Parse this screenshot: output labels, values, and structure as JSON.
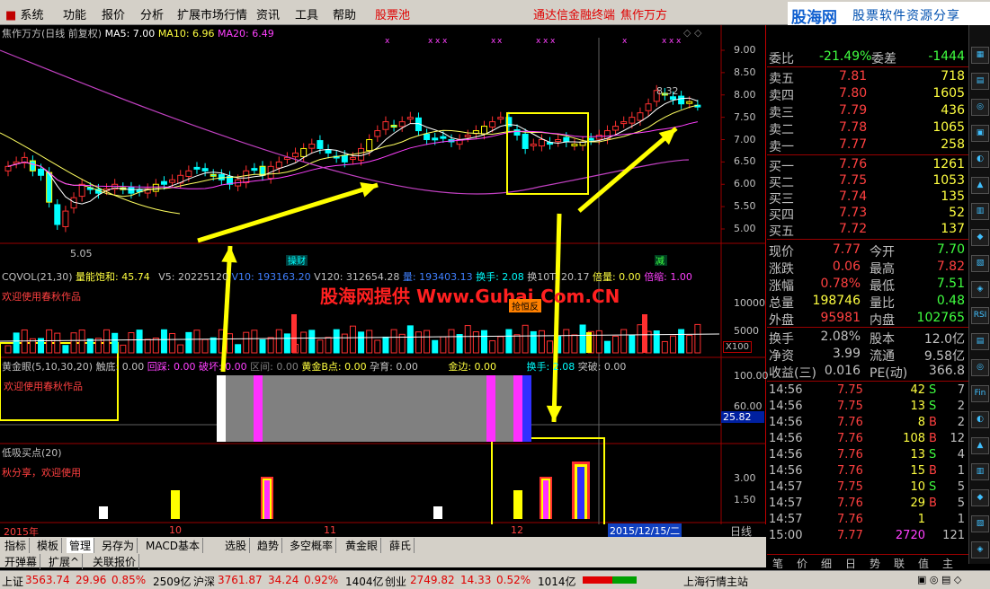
{
  "menu": {
    "items": [
      "系统",
      "功能",
      "报价",
      "分析",
      "扩展市场行情",
      "资讯",
      "工具",
      "帮助",
      "股票池"
    ],
    "center_text": "通达信金融终端",
    "stock_name": "焦作万方",
    "logo_main": "股海网",
    "logo_sub": "股票软件资源分享",
    "logo_url": "www.Guhai.com.cn"
  },
  "kline": {
    "title": "焦作万方(日线 前复权)",
    "ma5": "MA5: 7.00",
    "ma10": "MA10: 6.96",
    "ma20": "MA20: 6.49",
    "y_labels": [
      "9.00",
      "8.50",
      "8.00",
      "7.50",
      "7.00",
      "6.50",
      "6.00",
      "5.50",
      "5.00"
    ],
    "low_label": "5.05",
    "high_label": "8.32",
    "tag_left": "操财",
    "tag_right": "减"
  },
  "volume": {
    "title": "CQVOL(21,30)",
    "f1": "量能饱和: 45.74",
    "f2": "V5: 20225120",
    "f3": "V10: 193163.20",
    "f4": "V120: 312654.28",
    "f5": "量: 193403.13",
    "f6": "换手: 2.08",
    "f7": "换10T: 20.17",
    "f8": "倍量: 0.00",
    "f9": "倍缩: 1.00",
    "note": "欢迎使用春秋作品",
    "watermark": "股海网提供 Www.Guhai.Com.CN",
    "tag": "抢恒反",
    "y_labels": [
      "10000",
      "5000"
    ],
    "unit": "X100"
  },
  "golden": {
    "title": "黄金眼(5,10,30,20)",
    "f1": "触底: 0.00",
    "f2": "回踩: 0.00",
    "f3": "破坏: 0.00",
    "f4": "区间: 0.00",
    "f5": "黄金B点: 0.00",
    "f6": "孕育: 0.00",
    "f7": "金边: 0.00",
    "f8": "换手: 2.08",
    "f9": "突破: 0.00",
    "note": "欢迎使用春秋作品",
    "y_labels": [
      "100.00",
      "60.00"
    ],
    "current": "25.82"
  },
  "lowbuy": {
    "title": "低吸买点(20)",
    "note": "秋分享，欢迎使用",
    "y_labels": [
      "3.00",
      "1.50"
    ]
  },
  "xaxis": {
    "labels": [
      "2015年",
      "10",
      "11",
      "12"
    ],
    "date_box": "2015/12/15/二",
    "period": "日线"
  },
  "quote": {
    "weibi_label": "委比",
    "weibi_val": "-21.49%",
    "weicha_label": "委差",
    "weicha_val": "-1444",
    "asks": [
      {
        "l": "卖五",
        "p": "7.81",
        "v": "718"
      },
      {
        "l": "卖四",
        "p": "7.80",
        "v": "1605"
      },
      {
        "l": "卖三",
        "p": "7.79",
        "v": "436"
      },
      {
        "l": "卖二",
        "p": "7.78",
        "v": "1065"
      },
      {
        "l": "卖一",
        "p": "7.77",
        "v": "258"
      }
    ],
    "bids": [
      {
        "l": "买一",
        "p": "7.76",
        "v": "1261"
      },
      {
        "l": "买二",
        "p": "7.75",
        "v": "1053"
      },
      {
        "l": "买三",
        "p": "7.74",
        "v": "135"
      },
      {
        "l": "买四",
        "p": "7.73",
        "v": "52"
      },
      {
        "l": "买五",
        "p": "7.72",
        "v": "137"
      }
    ],
    "stats": [
      {
        "l1": "现价",
        "v1": "7.77",
        "c1": "#ff4040",
        "l2": "今开",
        "v2": "7.70",
        "c2": "#40ff40"
      },
      {
        "l1": "涨跌",
        "v1": "0.06",
        "c1": "#ff4040",
        "l2": "最高",
        "v2": "7.82",
        "c2": "#ff4040"
      },
      {
        "l1": "涨幅",
        "v1": "0.78%",
        "c1": "#ff4040",
        "l2": "最低",
        "v2": "7.51",
        "c2": "#40ff40"
      },
      {
        "l1": "总量",
        "v1": "198746",
        "c1": "#ffff40",
        "l2": "量比",
        "v2": "0.48",
        "c2": "#40ff40"
      },
      {
        "l1": "外盘",
        "v1": "95981",
        "c1": "#ff4040",
        "l2": "内盘",
        "v2": "102765",
        "c2": "#40ff40"
      }
    ],
    "stats2": [
      {
        "l1": "换手",
        "v1": "2.08%",
        "l2": "股本",
        "v2": "12.0亿"
      },
      {
        "l1": "净资",
        "v1": "3.99",
        "l2": "流通",
        "v2": "9.58亿"
      },
      {
        "l1": "收益(三)",
        "v1": "0.016",
        "l2": "PE(动)",
        "v2": "366.8"
      }
    ],
    "ticks": [
      {
        "t": "14:56",
        "p": "7.75",
        "v": "42",
        "d": "S",
        "n": "7"
      },
      {
        "t": "14:56",
        "p": "7.75",
        "v": "13",
        "d": "S",
        "n": "2"
      },
      {
        "t": "14:56",
        "p": "7.76",
        "v": "8",
        "d": "B",
        "n": "2"
      },
      {
        "t": "14:56",
        "p": "7.76",
        "v": "108",
        "d": "B",
        "n": "12"
      },
      {
        "t": "14:56",
        "p": "7.76",
        "v": "13",
        "d": "S",
        "n": "4"
      },
      {
        "t": "14:56",
        "p": "7.76",
        "v": "15",
        "d": "B",
        "n": "1"
      },
      {
        "t": "14:57",
        "p": "7.75",
        "v": "10",
        "d": "S",
        "n": "5"
      },
      {
        "t": "14:57",
        "p": "7.76",
        "v": "29",
        "d": "B",
        "n": "5"
      },
      {
        "t": "14:57",
        "p": "7.76",
        "v": "1",
        "d": "",
        "n": "1"
      },
      {
        "t": "15:00",
        "p": "7.77",
        "v": "2720",
        "d": "",
        "n": "121"
      }
    ],
    "tabs": [
      "笔",
      "价",
      "细",
      "日",
      "势",
      "联",
      "值",
      "主"
    ]
  },
  "bottom_tabs": [
    "指标",
    "模板",
    "管理",
    "另存为",
    "MACD基本",
    "选股",
    "趋势",
    "多空概率",
    "黄金眼",
    "薛氏"
  ],
  "bottom_tabs2": [
    "开弹幕",
    "扩展^",
    "关联报价"
  ],
  "status": {
    "sh_label": "上证",
    "sh_val": "3563.74",
    "sh_chg": "29.96",
    "sh_pct": "0.85%",
    "sh_amt": "2509亿",
    "sz_label": "沪深",
    "sz_val": "3761.87",
    "sz_chg": "34.24",
    "sz_pct": "0.92%",
    "sz_amt": "1404亿",
    "cy_label": "创业",
    "cy_val": "2749.82",
    "cy_chg": "14.33",
    "cy_pct": "0.52%",
    "cy_amt": "1014亿",
    "server": "上海行情主站"
  },
  "right_tools": [
    "RSI",
    "Fin"
  ]
}
